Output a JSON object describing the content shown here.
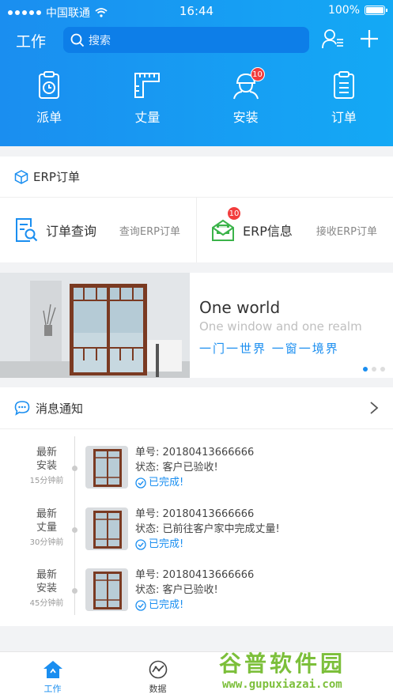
{
  "status_bar": {
    "carrier": "中国联通",
    "time": "16:44",
    "battery": "100%"
  },
  "nav": {
    "title": "工作",
    "search_placeholder": "搜索"
  },
  "quick_actions": [
    {
      "label": "派单",
      "icon": "clipboard-clock-icon"
    },
    {
      "label": "丈量",
      "icon": "ruler-icon"
    },
    {
      "label": "安装",
      "icon": "worker-icon",
      "badge": "10"
    },
    {
      "label": "订单",
      "icon": "order-list-icon"
    }
  ],
  "erp": {
    "title": "ERP订单",
    "items": [
      {
        "title": "订单查询",
        "subtitle": "查询ERP订单",
        "icon": "document-search-icon"
      },
      {
        "title": "ERP信息",
        "subtitle": "接收ERP订单",
        "icon": "mail-inbox-icon",
        "badge": "10"
      }
    ]
  },
  "banner": {
    "headline": "One world",
    "tagline": "One window and one realm",
    "slogan": "一门一世界  一窗一境界",
    "page_count": 3,
    "active_page": 1
  },
  "messages": {
    "title": "消息通知",
    "items": [
      {
        "type": "最新\n安装",
        "time": "15分钟前",
        "order_label": "单号:",
        "order_no": "20180413666666",
        "status_label": "状态:",
        "status": "客户已验收!",
        "done": "已完成!"
      },
      {
        "type": "最新\n丈量",
        "time": "30分钟前",
        "order_label": "单号:",
        "order_no": "20180413666666",
        "status_label": "状态:",
        "status": "已前往客户家中完成丈量!",
        "done": "已完成!"
      },
      {
        "type": "最新\n安装",
        "time": "45分钟前",
        "order_label": "单号:",
        "order_no": "20180413666666",
        "status_label": "状态:",
        "status": "客户已验收!",
        "done": "已完成!"
      }
    ]
  },
  "tabs": [
    {
      "label": "工作",
      "icon": "home-work-icon",
      "active": true
    },
    {
      "label": "数据",
      "icon": "chart-circle-icon",
      "active": false
    }
  ],
  "watermark": {
    "line1": "谷普软件园",
    "line2": "www.gupuxiazai.com"
  },
  "colors": {
    "primary": "#1a8ef0",
    "badge": "#f23d3d",
    "accent_green": "#3bb34a"
  }
}
